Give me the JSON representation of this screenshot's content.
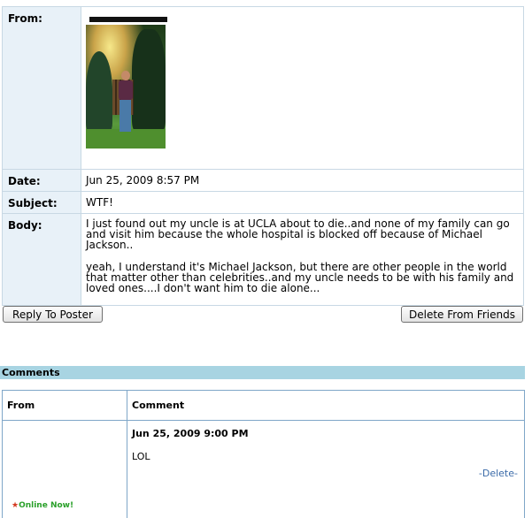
{
  "message": {
    "from_label": "From:",
    "date_label": "Date:",
    "date_value": "Jun 25, 2009 8:57 PM",
    "subject_label": "Subject:",
    "subject_value": "WTF!",
    "body_label": "Body:",
    "body_paragraph_1": "I just found out my uncle is at UCLA about to die..and none of my family can go and visit him because the whole hospital is blocked off because of Michael Jackson..",
    "body_paragraph_2": "yeah, I understand it's Michael Jackson, but there are other people in the world that matter other than celebrities..and my uncle needs to be with his family and loved ones....I don't want him to die alone..."
  },
  "actions": {
    "reply_label": "Reply To Poster",
    "delete_friends_label": "Delete From Friends"
  },
  "comments": {
    "section_title": "Comments",
    "col_from": "From",
    "col_comment": "Comment",
    "items": [
      {
        "date": "Jun 25, 2009 9:00 PM",
        "text": "LOL",
        "delete_label": "-Delete-",
        "online_status": "Online Now!"
      }
    ]
  }
}
